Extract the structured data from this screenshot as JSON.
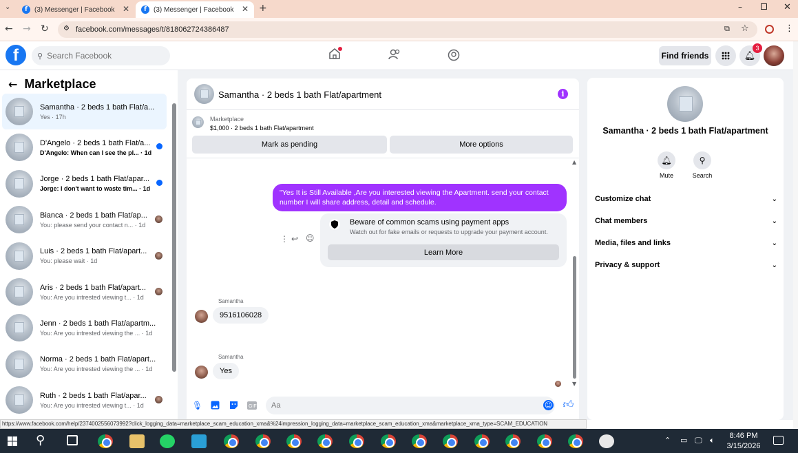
{
  "browser": {
    "tabs": [
      {
        "title": "(3) Messenger | Facebook",
        "active": false
      },
      {
        "title": "(3) Messenger | Facebook",
        "active": true
      }
    ],
    "url": "facebook.com/messages/t/818062724386487",
    "status_url": "https://www.facebook.com/help/2374002556073992?click_logging_data=marketplace_scam_education_xma&%24impression_logging_data=marketplace_scam_education_xma&marketplace_xma_type=SCAM_EDUCATION"
  },
  "header": {
    "search_placeholder": "Search Facebook",
    "find_friends": "Find friends",
    "notification_count": "3"
  },
  "sidebar": {
    "title": "Marketplace",
    "conversations": [
      {
        "name": "Samantha · 2 beds 1 bath Flat/a...",
        "preview": "Yes · 17h",
        "unread": false,
        "selected": true,
        "indicator": "none"
      },
      {
        "name": "D'Angelo · 2 beds 1 bath Flat/a...",
        "preview": "D'Angelo: When can I see the pl... · 1d",
        "unread": true,
        "selected": false,
        "indicator": "dot"
      },
      {
        "name": "Jorge · 2 beds 1 bath Flat/apar...",
        "preview": "Jorge: I don't want to waste tim... · 1d",
        "unread": true,
        "selected": false,
        "indicator": "dot"
      },
      {
        "name": "Bianca · 2 beds 1 bath Flat/ap...",
        "preview": "You: please send your contact n... · 1d",
        "unread": false,
        "selected": false,
        "indicator": "avatar"
      },
      {
        "name": "Luis · 2 beds 1 bath Flat/apart...",
        "preview": "You: please wait · 1d",
        "unread": false,
        "selected": false,
        "indicator": "avatar"
      },
      {
        "name": "Aris · 2 beds 1 bath Flat/apart...",
        "preview": "You: Are you intrested viewing t... · 1d",
        "unread": false,
        "selected": false,
        "indicator": "avatar"
      },
      {
        "name": "Jenn · 2 beds 1 bath Flat/apartm...",
        "preview": "You: Are you intrested viewing the ... · 1d",
        "unread": false,
        "selected": false,
        "indicator": "none"
      },
      {
        "name": "Norma · 2 beds 1 bath Flat/apart...",
        "preview": "You: Are you intrested viewing the ... · 1d",
        "unread": false,
        "selected": false,
        "indicator": "none"
      },
      {
        "name": "Ruth · 2 beds 1 bath Flat/apar...",
        "preview": "You: Are you intrested viewing t... · 1d",
        "unread": false,
        "selected": false,
        "indicator": "avatar"
      }
    ]
  },
  "chat": {
    "title": "Samantha · 2 beds 1 bath Flat/apartment",
    "listing_label": "Marketplace",
    "listing_price": "$1,000 · 2 beds 1 bath Flat/apartment",
    "mark_pending": "Mark as pending",
    "more_options": "More options",
    "outgoing_message": "\"Yes It is Still Available ,Are you interested viewing the Apartment. send your contact number I will share address, detail and schedule.",
    "warning_title": "Beware of common scams using payment apps",
    "warning_subtitle": "Watch out for fake emails or requests to upgrade your payment account.",
    "learn_more": "Learn More",
    "messages": [
      {
        "sender": "Samantha",
        "text": "9516106028"
      },
      {
        "sender": "Samantha",
        "text": "Yes"
      }
    ],
    "composer_placeholder": "Aa"
  },
  "details": {
    "name": "Samantha · 2 beds 1 bath Flat/apartment",
    "mute": "Mute",
    "search": "Search",
    "sections": [
      "Customize chat",
      "Chat members",
      "Media, files and links",
      "Privacy & support"
    ]
  },
  "taskbar": {
    "time": "8:46 PM",
    "date": "3/15/2026"
  },
  "colors": {
    "accent": "#a033ff",
    "facebook_blue": "#1877f2",
    "messenger_blue": "#0866ff",
    "notification_red": "#e41e3f",
    "tabbar": "#f6d9cb"
  }
}
